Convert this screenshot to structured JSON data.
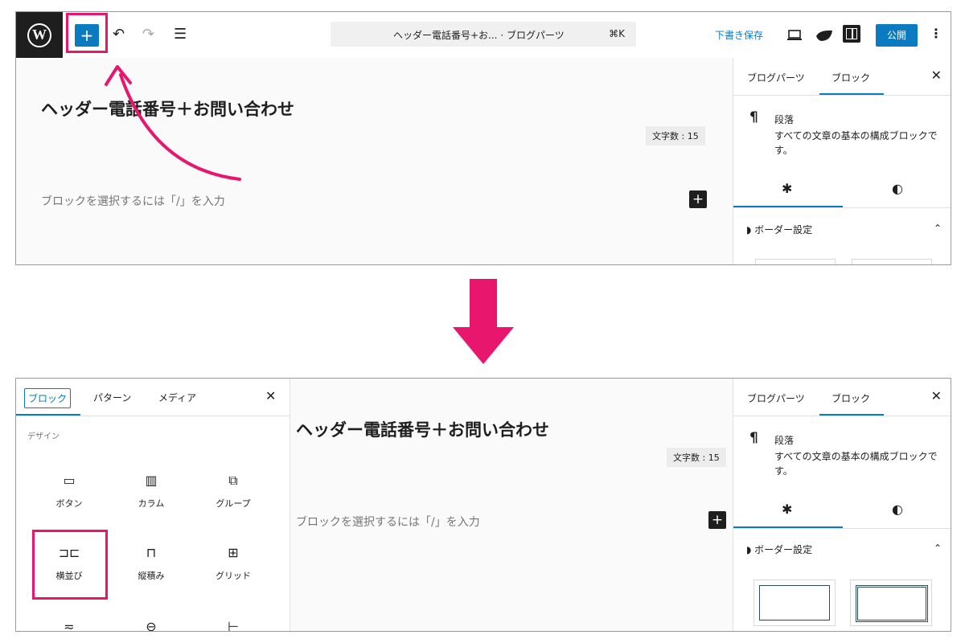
{
  "top": {
    "toolbar": {
      "inserter_label": "+",
      "undo_label": "↶",
      "redo_label": "↷",
      "list_view_label": "☰",
      "command_title": "ヘッダー電話番号+お... · ブログパーツ",
      "command_shortcut": "⌘K",
      "save_draft": "下書き保存",
      "publish": "公開"
    },
    "canvas": {
      "title": "ヘッダー電話番号＋お問い合わせ",
      "word_count": "文字数 : 15",
      "placeholder": "ブロックを選択するには「/」を入力"
    }
  },
  "bottom": {
    "inserter_panel": {
      "tabs": [
        "ブロック",
        "パターン",
        "メディア"
      ],
      "active_tab": "ブロック",
      "category": "デザイン",
      "blocks": [
        {
          "label": "ボタン",
          "icon": "▭"
        },
        {
          "label": "カラム",
          "icon": "▥"
        },
        {
          "label": "グループ",
          "icon": "⧉"
        },
        {
          "label": "横並び",
          "icon": "⊐⊏"
        },
        {
          "label": "縦積み",
          "icon": "⊓"
        },
        {
          "label": "グリッド",
          "icon": "⊞"
        },
        {
          "label": "",
          "icon": "≂"
        },
        {
          "label": "",
          "icon": "⊖"
        },
        {
          "label": "",
          "icon": "⊢"
        }
      ]
    },
    "canvas": {
      "title": "ヘッダー電話番号＋お問い合わせ",
      "word_count": "文字数 : 15",
      "placeholder": "ブロックを選択するには「/」を入力"
    }
  },
  "sidebar": {
    "tabs": [
      "ブログパーツ",
      "ブロック"
    ],
    "active_tab": "ブロック",
    "close": "✕",
    "block_name": "段落",
    "block_desc": "すべての文章の基本の構成ブロックです。",
    "pilcrow": "¶",
    "settings_icon": "✱",
    "styles_icon": "◐",
    "border_section": "ボーダー設定",
    "chevron": "⌃"
  },
  "colors": {
    "accent": "#0a7bc1",
    "highlight": "#e8166c",
    "dark": "#1e1e1e"
  }
}
